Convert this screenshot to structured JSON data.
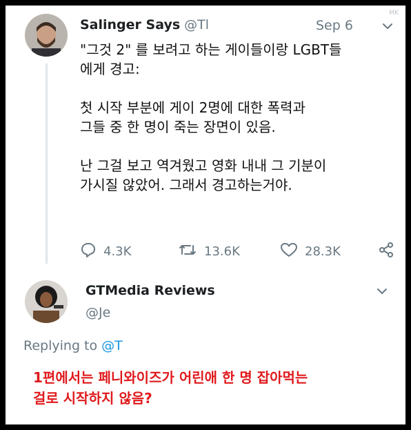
{
  "watermark": "MK",
  "tweet": {
    "author_name": "Salinger Says",
    "author_handle": "@Tl",
    "date": "Sep 6",
    "text": "\"그것 2\" 를 보려고 하는 게이들이랑 LGBT들\n에게 경고:\n\n첫 시작 부분에 게이 2명에 대한 폭력과\n그들 중 한 명이 죽는 장면이 있음.\n\n난 그걸 보고 역겨웠고 영화 내내 그 기분이\n가시질 않았어. 그래서 경고하는거야.",
    "replies": "4.3K",
    "retweets": "13.6K",
    "likes": "28.3K"
  },
  "reply": {
    "author_name": "GTMedia Reviews",
    "author_handle": "@Je",
    "replying_prefix": "Replying to",
    "replying_mention": "@T",
    "text": "1편에서는 페니와이즈가 어린애 한 명 잡아먹는\n걸로 시작하지 않음?"
  },
  "icons": {
    "reply": "speech-bubble-icon",
    "retweet": "retweet-arrows-icon",
    "like": "heart-outline-icon",
    "share": "share-nodes-icon",
    "menu": "chevron-down-icon"
  },
  "colors": {
    "muted": "#697882",
    "link": "#1b95e0",
    "reply_text": "#e0191c"
  }
}
